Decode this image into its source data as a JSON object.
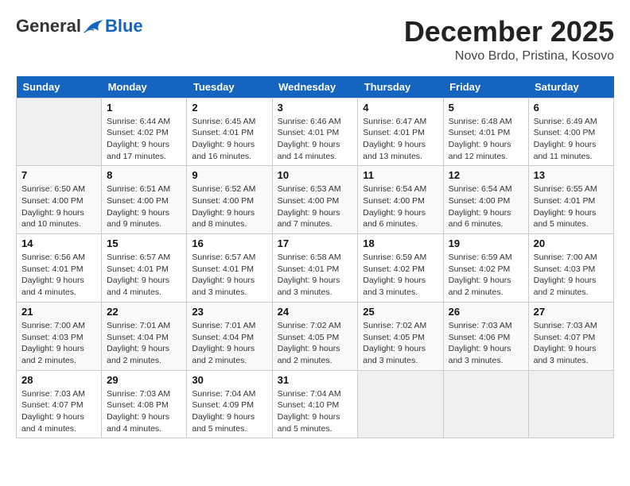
{
  "header": {
    "logo_general": "General",
    "logo_blue": "Blue",
    "title": "December 2025",
    "subtitle": "Novo Brdo, Pristina, Kosovo"
  },
  "days_of_week": [
    "Sunday",
    "Monday",
    "Tuesday",
    "Wednesday",
    "Thursday",
    "Friday",
    "Saturday"
  ],
  "weeks": [
    [
      {
        "day": "",
        "sunrise": "",
        "sunset": "",
        "daylight": ""
      },
      {
        "day": "1",
        "sunrise": "Sunrise: 6:44 AM",
        "sunset": "Sunset: 4:02 PM",
        "daylight": "Daylight: 9 hours and 17 minutes."
      },
      {
        "day": "2",
        "sunrise": "Sunrise: 6:45 AM",
        "sunset": "Sunset: 4:01 PM",
        "daylight": "Daylight: 9 hours and 16 minutes."
      },
      {
        "day": "3",
        "sunrise": "Sunrise: 6:46 AM",
        "sunset": "Sunset: 4:01 PM",
        "daylight": "Daylight: 9 hours and 14 minutes."
      },
      {
        "day": "4",
        "sunrise": "Sunrise: 6:47 AM",
        "sunset": "Sunset: 4:01 PM",
        "daylight": "Daylight: 9 hours and 13 minutes."
      },
      {
        "day": "5",
        "sunrise": "Sunrise: 6:48 AM",
        "sunset": "Sunset: 4:01 PM",
        "daylight": "Daylight: 9 hours and 12 minutes."
      },
      {
        "day": "6",
        "sunrise": "Sunrise: 6:49 AM",
        "sunset": "Sunset: 4:00 PM",
        "daylight": "Daylight: 9 hours and 11 minutes."
      }
    ],
    [
      {
        "day": "7",
        "sunrise": "Sunrise: 6:50 AM",
        "sunset": "Sunset: 4:00 PM",
        "daylight": "Daylight: 9 hours and 10 minutes."
      },
      {
        "day": "8",
        "sunrise": "Sunrise: 6:51 AM",
        "sunset": "Sunset: 4:00 PM",
        "daylight": "Daylight: 9 hours and 9 minutes."
      },
      {
        "day": "9",
        "sunrise": "Sunrise: 6:52 AM",
        "sunset": "Sunset: 4:00 PM",
        "daylight": "Daylight: 9 hours and 8 minutes."
      },
      {
        "day": "10",
        "sunrise": "Sunrise: 6:53 AM",
        "sunset": "Sunset: 4:00 PM",
        "daylight": "Daylight: 9 hours and 7 minutes."
      },
      {
        "day": "11",
        "sunrise": "Sunrise: 6:54 AM",
        "sunset": "Sunset: 4:00 PM",
        "daylight": "Daylight: 9 hours and 6 minutes."
      },
      {
        "day": "12",
        "sunrise": "Sunrise: 6:54 AM",
        "sunset": "Sunset: 4:00 PM",
        "daylight": "Daylight: 9 hours and 6 minutes."
      },
      {
        "day": "13",
        "sunrise": "Sunrise: 6:55 AM",
        "sunset": "Sunset: 4:01 PM",
        "daylight": "Daylight: 9 hours and 5 minutes."
      }
    ],
    [
      {
        "day": "14",
        "sunrise": "Sunrise: 6:56 AM",
        "sunset": "Sunset: 4:01 PM",
        "daylight": "Daylight: 9 hours and 4 minutes."
      },
      {
        "day": "15",
        "sunrise": "Sunrise: 6:57 AM",
        "sunset": "Sunset: 4:01 PM",
        "daylight": "Daylight: 9 hours and 4 minutes."
      },
      {
        "day": "16",
        "sunrise": "Sunrise: 6:57 AM",
        "sunset": "Sunset: 4:01 PM",
        "daylight": "Daylight: 9 hours and 3 minutes."
      },
      {
        "day": "17",
        "sunrise": "Sunrise: 6:58 AM",
        "sunset": "Sunset: 4:01 PM",
        "daylight": "Daylight: 9 hours and 3 minutes."
      },
      {
        "day": "18",
        "sunrise": "Sunrise: 6:59 AM",
        "sunset": "Sunset: 4:02 PM",
        "daylight": "Daylight: 9 hours and 3 minutes."
      },
      {
        "day": "19",
        "sunrise": "Sunrise: 6:59 AM",
        "sunset": "Sunset: 4:02 PM",
        "daylight": "Daylight: 9 hours and 2 minutes."
      },
      {
        "day": "20",
        "sunrise": "Sunrise: 7:00 AM",
        "sunset": "Sunset: 4:03 PM",
        "daylight": "Daylight: 9 hours and 2 minutes."
      }
    ],
    [
      {
        "day": "21",
        "sunrise": "Sunrise: 7:00 AM",
        "sunset": "Sunset: 4:03 PM",
        "daylight": "Daylight: 9 hours and 2 minutes."
      },
      {
        "day": "22",
        "sunrise": "Sunrise: 7:01 AM",
        "sunset": "Sunset: 4:04 PM",
        "daylight": "Daylight: 9 hours and 2 minutes."
      },
      {
        "day": "23",
        "sunrise": "Sunrise: 7:01 AM",
        "sunset": "Sunset: 4:04 PM",
        "daylight": "Daylight: 9 hours and 2 minutes."
      },
      {
        "day": "24",
        "sunrise": "Sunrise: 7:02 AM",
        "sunset": "Sunset: 4:05 PM",
        "daylight": "Daylight: 9 hours and 2 minutes."
      },
      {
        "day": "25",
        "sunrise": "Sunrise: 7:02 AM",
        "sunset": "Sunset: 4:05 PM",
        "daylight": "Daylight: 9 hours and 3 minutes."
      },
      {
        "day": "26",
        "sunrise": "Sunrise: 7:03 AM",
        "sunset": "Sunset: 4:06 PM",
        "daylight": "Daylight: 9 hours and 3 minutes."
      },
      {
        "day": "27",
        "sunrise": "Sunrise: 7:03 AM",
        "sunset": "Sunset: 4:07 PM",
        "daylight": "Daylight: 9 hours and 3 minutes."
      }
    ],
    [
      {
        "day": "28",
        "sunrise": "Sunrise: 7:03 AM",
        "sunset": "Sunset: 4:07 PM",
        "daylight": "Daylight: 9 hours and 4 minutes."
      },
      {
        "day": "29",
        "sunrise": "Sunrise: 7:03 AM",
        "sunset": "Sunset: 4:08 PM",
        "daylight": "Daylight: 9 hours and 4 minutes."
      },
      {
        "day": "30",
        "sunrise": "Sunrise: 7:04 AM",
        "sunset": "Sunset: 4:09 PM",
        "daylight": "Daylight: 9 hours and 5 minutes."
      },
      {
        "day": "31",
        "sunrise": "Sunrise: 7:04 AM",
        "sunset": "Sunset: 4:10 PM",
        "daylight": "Daylight: 9 hours and 5 minutes."
      },
      {
        "day": "",
        "sunrise": "",
        "sunset": "",
        "daylight": ""
      },
      {
        "day": "",
        "sunrise": "",
        "sunset": "",
        "daylight": ""
      },
      {
        "day": "",
        "sunrise": "",
        "sunset": "",
        "daylight": ""
      }
    ]
  ]
}
